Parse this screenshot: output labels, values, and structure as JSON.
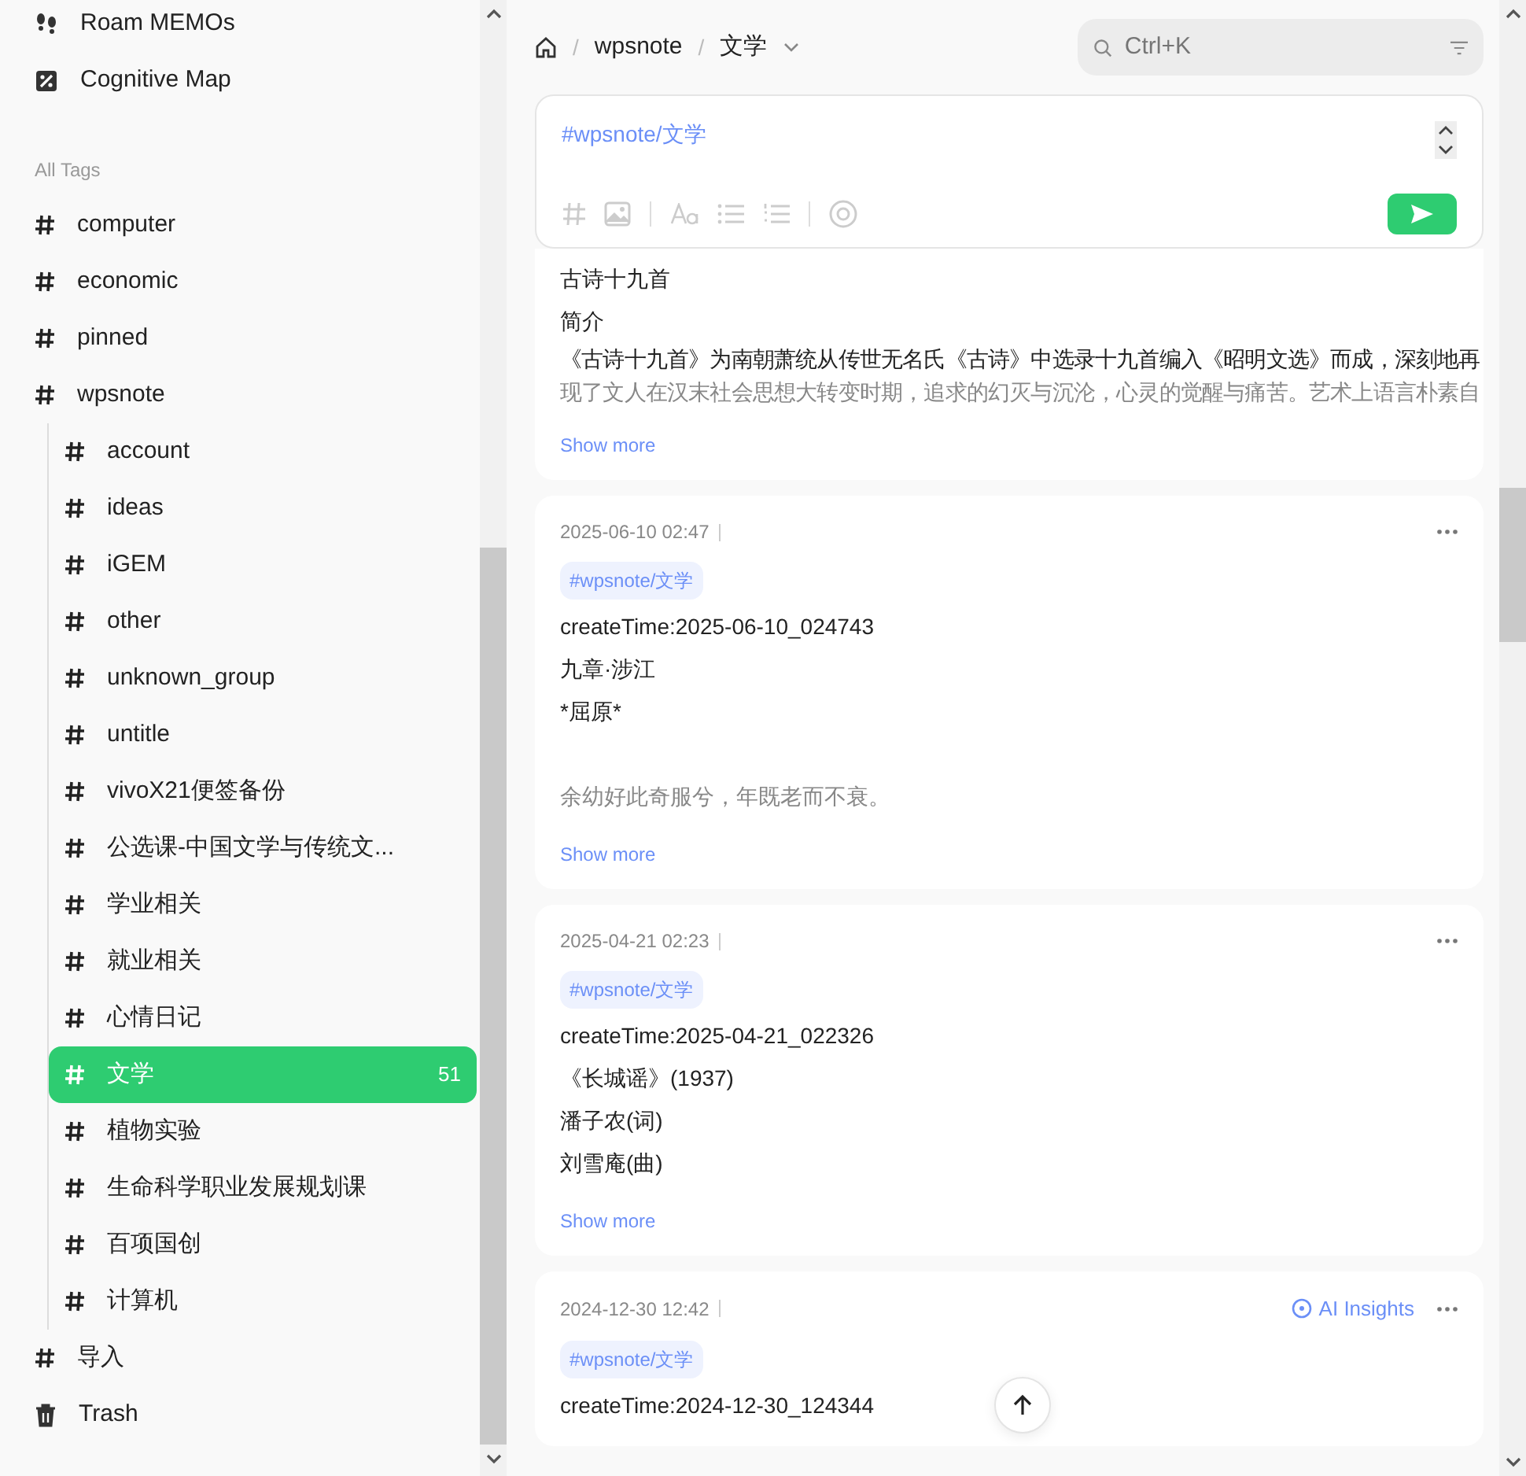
{
  "sidebar": {
    "nav": [
      {
        "kind": "roam",
        "label": "Roam MEMOs"
      },
      {
        "kind": "map",
        "label": "Cognitive Map"
      }
    ],
    "tags_heading": "All Tags",
    "tags": [
      {
        "label": "computer",
        "selected": false
      },
      {
        "label": "economic",
        "selected": false
      },
      {
        "label": "pinned",
        "selected": false
      },
      {
        "label": "wpsnote",
        "selected": false,
        "children": [
          {
            "label": "account",
            "selected": false
          },
          {
            "label": "ideas",
            "selected": false
          },
          {
            "label": "iGEM",
            "selected": false
          },
          {
            "label": "other",
            "selected": false
          },
          {
            "label": "unknown_group",
            "selected": false
          },
          {
            "label": "untitle",
            "selected": false
          },
          {
            "label": "vivoX21便签备份",
            "selected": false
          },
          {
            "label": "公选课-中国文学与传统文...",
            "selected": false
          },
          {
            "label": "学业相关",
            "selected": false
          },
          {
            "label": "就业相关",
            "selected": false
          },
          {
            "label": "心情日记",
            "selected": false
          },
          {
            "label": "文学",
            "selected": true,
            "count": "51"
          },
          {
            "label": "植物实验",
            "selected": false
          },
          {
            "label": "生命科学职业发展规划课",
            "selected": false
          },
          {
            "label": "百项国创",
            "selected": false
          },
          {
            "label": "计算机",
            "selected": false
          }
        ]
      },
      {
        "label": "导入",
        "selected": false
      }
    ],
    "trash": "Trash"
  },
  "breadcrumb": {
    "separator": "/",
    "items": [
      "wpsnote",
      "文学"
    ]
  },
  "search": {
    "placeholder": "Ctrl+K"
  },
  "editor": {
    "text": "#wpsnote/文学"
  },
  "memos": [
    {
      "lines": [
        {
          "text": "古诗十九首",
          "muted": false
        },
        {
          "text": "简介",
          "muted": false
        },
        {
          "text": "《古诗十九首》为南朝萧统从传世无名氏《古诗》中选录十九首编入《昭明文选》而成，深刻地再",
          "muted": false
        },
        {
          "text": "现了文人在汉末社会思想大转变时期，追求的幻灭与沉沦，心灵的觉醒与痛苦。艺术上语言朴素自",
          "muted": true
        }
      ],
      "show_more": "Show more"
    },
    {
      "time": "2025-06-10 02:47",
      "tag": "#wpsnote/文学",
      "lines": [
        {
          "text": "createTime:2025-06-10_024743",
          "muted": false
        },
        {
          "text": "九章·涉江",
          "muted": false
        },
        {
          "text": "*屈原*",
          "muted": false
        },
        {
          "text": "余幼好此奇服兮，年既老而不衰。",
          "muted": true,
          "blank_before": true
        }
      ],
      "show_more": "Show more"
    },
    {
      "time": "2025-04-21 02:23",
      "tag": "#wpsnote/文学",
      "lines": [
        {
          "text": "createTime:2025-04-21_022326",
          "muted": false
        },
        {
          "text": "《长城谣》(1937)",
          "muted": false
        },
        {
          "text": "潘子农(词)",
          "muted": false
        },
        {
          "text": "刘雪庵(曲)",
          "muted": false
        }
      ],
      "show_more": "Show more"
    },
    {
      "time": "2024-12-30 12:42",
      "ai_insights": "AI Insights",
      "tag": "#wpsnote/文学",
      "lines": [
        {
          "text": "createTime:2024-12-30_124344",
          "muted": false
        }
      ]
    }
  ]
}
